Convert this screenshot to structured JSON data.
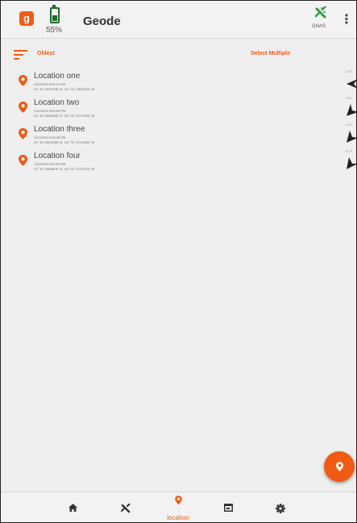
{
  "header": {
    "logo_letter": "g",
    "battery_percent": "55%",
    "battery_level": 0.55,
    "title": "Geode",
    "gnss_label": "GNAS",
    "menu_glyph": "⋮"
  },
  "toolbar": {
    "sort_label": "Oldest",
    "select_multiple_label": "Select Multiple"
  },
  "locations": [
    {
      "name": "Location one",
      "time": "1/12/2022 5:50:13 PM",
      "coords": "41° 45.74575230' N, 111° 51.73601010' W",
      "distance": "2.3 f"
    },
    {
      "name": "Location two",
      "time": "1/12/2022 5:50:26 PM",
      "coords": "41° 45.74566650' N, 111° 51.72770150' W",
      "distance": "1.3 f"
    },
    {
      "name": "Location three",
      "time": "1/12/2022 5:50:40 PM",
      "coords": "41° 45.74564280' N, 111° 51.72741860' W",
      "distance": "1.0 f"
    },
    {
      "name": "Location four",
      "time": "1/12/2022 5:50:53 PM",
      "coords": "41° 45.74566670' N, 111° 51.72741070' W",
      "distance": "0.7 f"
    }
  ],
  "bottom_nav": {
    "items": [
      {
        "icon": "home-icon"
      },
      {
        "icon": "satellite-icon"
      },
      {
        "icon": "location-pin-icon",
        "label": "location",
        "active": true
      },
      {
        "icon": "map-icon"
      },
      {
        "icon": "gear-icon"
      }
    ]
  },
  "colors": {
    "accent": "#f05a14",
    "battery": "#1c6a2b",
    "gnss": "#2e9e3e",
    "text": "#333333"
  }
}
